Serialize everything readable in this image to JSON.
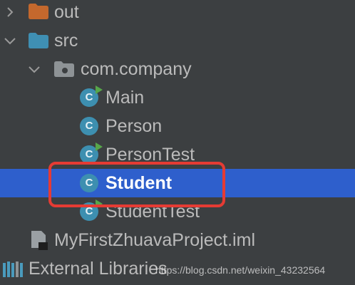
{
  "tree": {
    "out": "out",
    "src": "src",
    "package": "com.company",
    "classes": [
      "Main",
      "Person",
      "PersonTest",
      "Student",
      "StudentTest"
    ],
    "iml_file": "MyFirstZhuavaProject.iml",
    "external_libraries": "External Libraries",
    "selected": "Student"
  },
  "class_icon_letter": "C",
  "watermark": "https://blog.csdn.net/weixin_43232564",
  "colors": {
    "background": "#3c3f41",
    "selection": "#2e5fcc",
    "highlight_border": "#e53b34",
    "folder_orange": "#c4682d",
    "folder_blue": "#3f8fb3",
    "class_icon": "#3d8fb0",
    "run_marker": "#57a64a"
  }
}
